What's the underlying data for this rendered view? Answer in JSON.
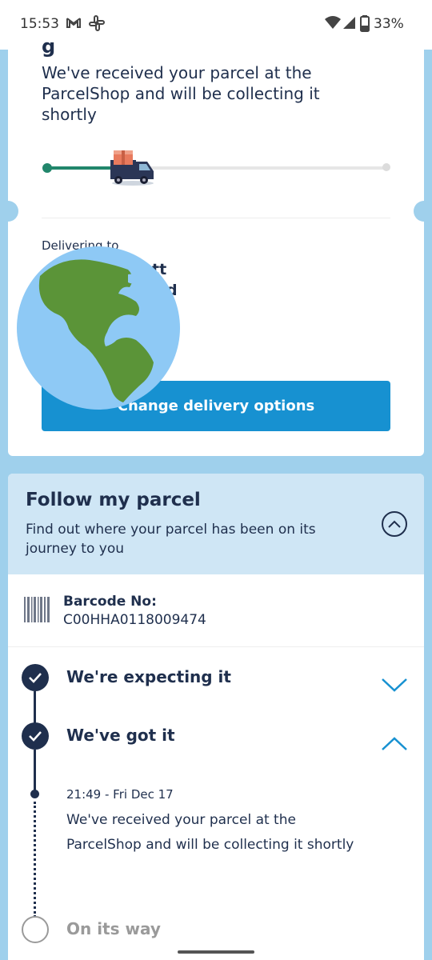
{
  "status_bar": {
    "time": "15:53",
    "battery": "33%",
    "icons": [
      "gmail-icon",
      "slack-icon",
      "wifi-icon",
      "signal-icon",
      "battery-icon"
    ]
  },
  "delivery": {
    "title_partial": "g",
    "status_message": "We've received your parcel at the ParcelShop and will be collecting it shortly",
    "progress": 0.2,
    "delivering_to_label": "Delivering to",
    "name_fragment_1": "tt",
    "name_fragment_2": "d",
    "change_button_label": "Change delivery options"
  },
  "follow": {
    "title": "Follow my parcel",
    "subtitle": "Find out where your parcel has been on its journey to you",
    "barcode_label": "Barcode No:",
    "barcode_value": "C00HHA0118009474",
    "steps": [
      {
        "label": "We're expecting it",
        "state": "done",
        "expanded": false
      },
      {
        "label": "We've got it",
        "state": "done",
        "expanded": true
      },
      {
        "label": "On its way",
        "state": "pending",
        "expanded": false
      }
    ],
    "event": {
      "time": "21:49 - Fri Dec 17",
      "message": "We've received your parcel at the ParcelShop and will be collecting it shortly"
    }
  },
  "colors": {
    "navy": "#1f2f4d",
    "accent_blue": "#1791d1",
    "progress_green": "#21866b",
    "background_blue": "#9fd0ec",
    "header_light_blue": "#cfe6f5"
  }
}
